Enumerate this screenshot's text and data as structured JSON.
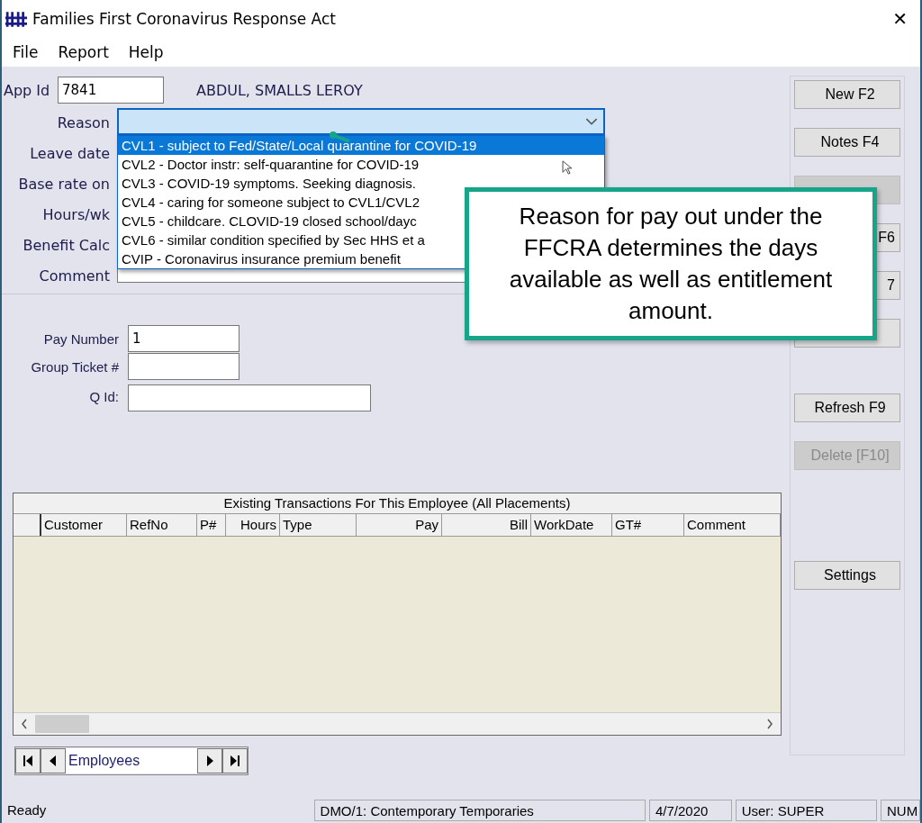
{
  "window": {
    "title": "Families First Coronavirus Response Act",
    "close": "✕"
  },
  "menu": [
    "File",
    "Report",
    "Help"
  ],
  "app_id": {
    "label": "App Id",
    "value": "7841",
    "employee": "ABDUL, SMALLS LEROY"
  },
  "form_labels": [
    "Reason",
    "Leave date",
    "Base rate on",
    "Hours/wk",
    "Benefit Calc",
    "Comment"
  ],
  "reason_dropdown": {
    "expanded": true,
    "options": [
      {
        "text": "CVL1 - subject to Fed/State/Local quarantine for COVID-19",
        "selected": true
      },
      {
        "text": "CVL2 - Doctor instr: self-quarantine for COVID-19",
        "selected": false
      },
      {
        "text": "CVL3 - COVID-19 symptoms. Seeking diagnosis.",
        "selected": false
      },
      {
        "text": "CVL4 - caring for someone subject to CVL1/CVL2",
        "selected": false
      },
      {
        "text": "CVL5 - childcare. CLOVID-19 closed school/dayc",
        "selected": false
      },
      {
        "text": "CVL6 - similar condition specified by Sec HHS et a",
        "selected": false
      },
      {
        "text": "CVIP - Coronavirus insurance premium benefit",
        "selected": false
      }
    ]
  },
  "pay_fields": [
    {
      "label": "Pay Number",
      "value": "1"
    },
    {
      "label": "Group Ticket #"
    },
    {
      "label": "Q Id:"
    }
  ],
  "buttons": [
    {
      "label": "New F2",
      "disabled": false
    },
    {
      "label": "Notes F4",
      "disabled": false
    },
    {
      "disabled": true
    },
    {
      "label": "F6",
      "disabled": false
    },
    {
      "label": "7",
      "disabled": false
    },
    {
      "disabled": false
    },
    {
      "label": "Refresh F9",
      "disabled": false
    },
    {
      "label": "Delete [F10]",
      "disabled": true
    },
    {
      "label": "Settings",
      "disabled": false
    }
  ],
  "table": {
    "title": "Existing Transactions For This Employee (All Placements)",
    "columns": [
      "Customer",
      "RefNo",
      "P#",
      "Hours",
      "Type",
      "Pay",
      "Bill",
      "WorkDate",
      "GT#",
      "Comment"
    ]
  },
  "navigator": {
    "value": "Employees"
  },
  "callout": {
    "text": "Reason for pay out under the FFCRA determines the days available as well as entitlement amount."
  },
  "status_bar": [
    "Ready",
    "DMO/1: Contemporary Temporaries",
    "4/7/2020",
    "User: SUPER",
    "NUM"
  ]
}
